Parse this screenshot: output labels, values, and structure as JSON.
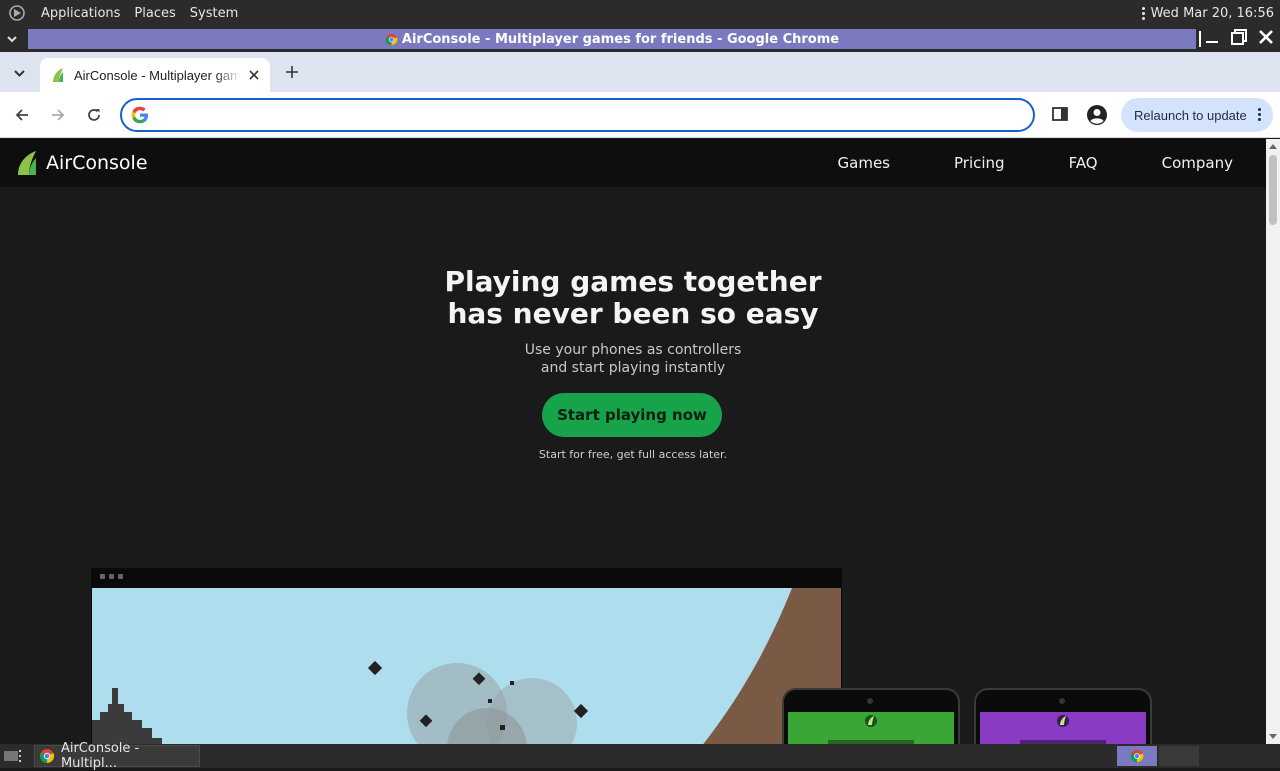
{
  "top_panel": {
    "menus": [
      "Applications",
      "Places",
      "System"
    ],
    "clock": "Wed Mar 20, 16:56"
  },
  "window": {
    "title": "AirConsole - Multiplayer games for friends - Google Chrome"
  },
  "browser": {
    "tab_title": "AirConsole - Multiplayer games for friends",
    "omnibox_value": "",
    "relaunch_label": "Relaunch to update",
    "accent": "#1a5fd0"
  },
  "site": {
    "brand": "AirConsole",
    "nav": [
      "Games",
      "Pricing",
      "FAQ",
      "Company"
    ],
    "hero_title_line1": "Playing games together",
    "hero_title_line2": "has never been so easy",
    "hero_sub_line1": "Use your phones as controllers",
    "hero_sub_line2": "and start playing instantly",
    "cta_label": "Start playing now",
    "cta_note": "Start for free, get full access later.",
    "cta_color": "#16a34a",
    "phone_colors": [
      "#3aa636",
      "#8a3bc4"
    ]
  },
  "taskbar": {
    "task_label": "AirConsole - Multipl..."
  }
}
